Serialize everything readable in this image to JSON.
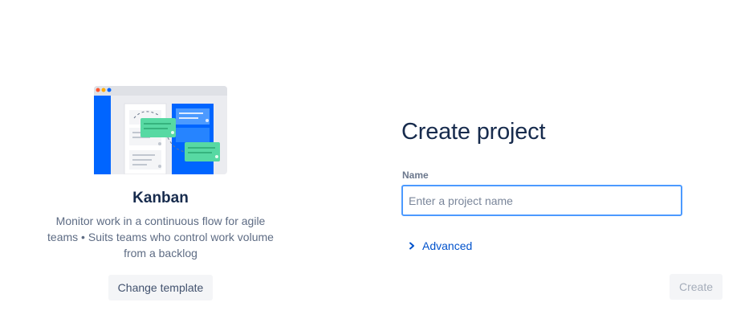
{
  "template": {
    "name": "Kanban",
    "description": "Monitor work in a continuous flow for agile teams • Suits teams who control work volume from a backlog",
    "change_label": "Change template",
    "illustration_icon": "kanban-board-illustration",
    "colors": {
      "blue": "#0065ff",
      "green": "#57d9a3",
      "window_red": "#ff5630",
      "window_yellow": "#ffab00",
      "window_blue": "#0065ff"
    }
  },
  "form": {
    "title": "Create project",
    "name_label": "Name",
    "name_value": "",
    "name_placeholder": "Enter a project name",
    "advanced_label": "Advanced",
    "advanced_icon": "chevron-right-icon",
    "create_label": "Create"
  },
  "colors": {
    "accent": "#0052cc",
    "focus_border": "#4c9aff",
    "disabled_text": "#a5adba",
    "title_text": "#172b4d"
  }
}
